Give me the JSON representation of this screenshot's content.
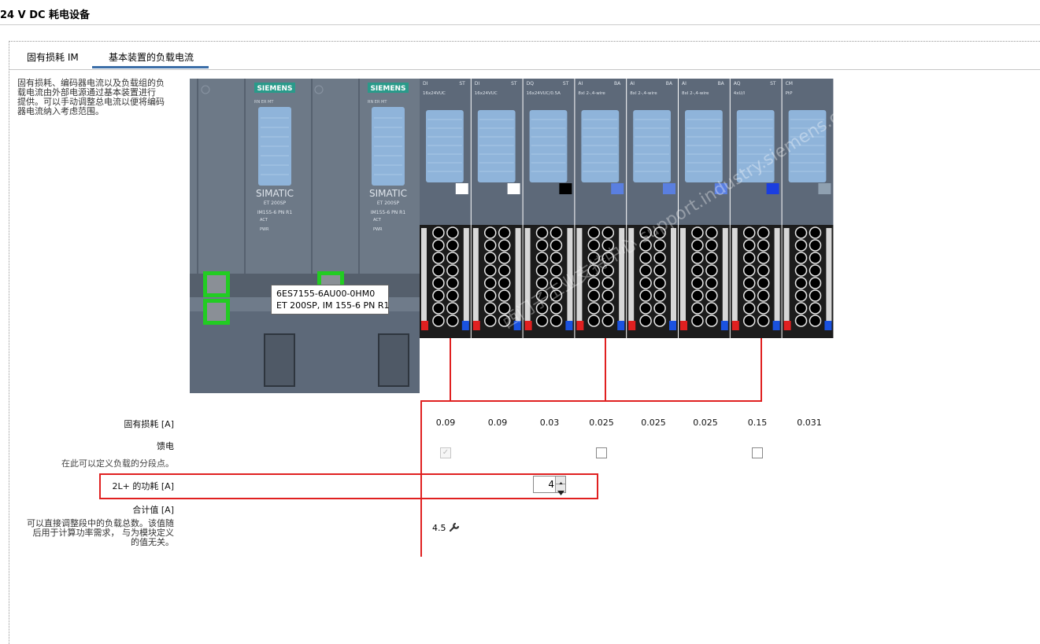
{
  "page": {
    "title": "24 V DC 耗电设备"
  },
  "tabs": [
    {
      "label": "固有损耗 IM"
    },
    {
      "label": "基本装置的负载电流"
    }
  ],
  "description": [
    "固有损耗、编码器电流以及负载组的负",
    "载电流由外部电源通过基本装置进行",
    "提供。可以手动调整总电流以便将编码",
    "器电流纳入考虑范围。"
  ],
  "hardware": {
    "brand": "SIEMENS",
    "head": {
      "simatic": "SIMATIC",
      "family": "ET 200SP",
      "model": "IM155-6 PN R1",
      "led1": "ACT",
      "led2": "PWR",
      "port_leds": "RN ER MT"
    },
    "tooltip": {
      "line1": "6ES7155-6AU00-0HM0",
      "line2": "ET 200SP, IM 155-6 PN R1"
    },
    "modules": [
      {
        "type": "DI",
        "st": "ST",
        "desc": "16x24VUC"
      },
      {
        "type": "DI",
        "st": "ST",
        "desc": "16x24VUC"
      },
      {
        "type": "DQ",
        "st": "ST",
        "desc": "16x24VUC/0.5A"
      },
      {
        "type": "AI",
        "st": "BA",
        "desc": "8xI 2-,4-wire"
      },
      {
        "type": "AI",
        "st": "BA",
        "desc": "8xI 2-,4-wire"
      },
      {
        "type": "AI",
        "st": "BA",
        "desc": "8xI 2-,4-wire"
      },
      {
        "type": "AQ",
        "st": "ST",
        "desc": "4xU/I"
      },
      {
        "type": "CM",
        "st": "",
        "desc": "PtP"
      }
    ],
    "watermark": "西门子工业支持中心 support.industry.siemens.com/cs"
  },
  "rows": {
    "inherent_loss": {
      "label": "固有损耗 [A]",
      "values": [
        "0.09",
        "0.09",
        "0.03",
        "0.025",
        "0.025",
        "0.025",
        "0.15",
        "0.031"
      ]
    },
    "feed": {
      "label": "馈电",
      "sub": "在此可以定义负载的分段点。",
      "checks": [
        {
          "module": 1,
          "checked": true,
          "disabled": true
        },
        {
          "module": 4,
          "checked": false,
          "disabled": false
        },
        {
          "module": 7,
          "checked": false,
          "disabled": false
        }
      ]
    },
    "power_2l": {
      "label": "2L+ 的功耗 [A]",
      "value": "4"
    },
    "total": {
      "label": "合计值 [A]",
      "value": "4.5",
      "desc": [
        "可以直接调整段中的负载总数。该值随",
        "后用于计算功率需求， 与为模块定义",
        "的值无关。"
      ]
    }
  },
  "colors": {
    "accent": "#3b6ea8",
    "highlight": "#e02020",
    "terminal_green": "#22cc22",
    "panel": "#5d6979"
  },
  "icons": {
    "total_tool": "wrench-icon"
  }
}
